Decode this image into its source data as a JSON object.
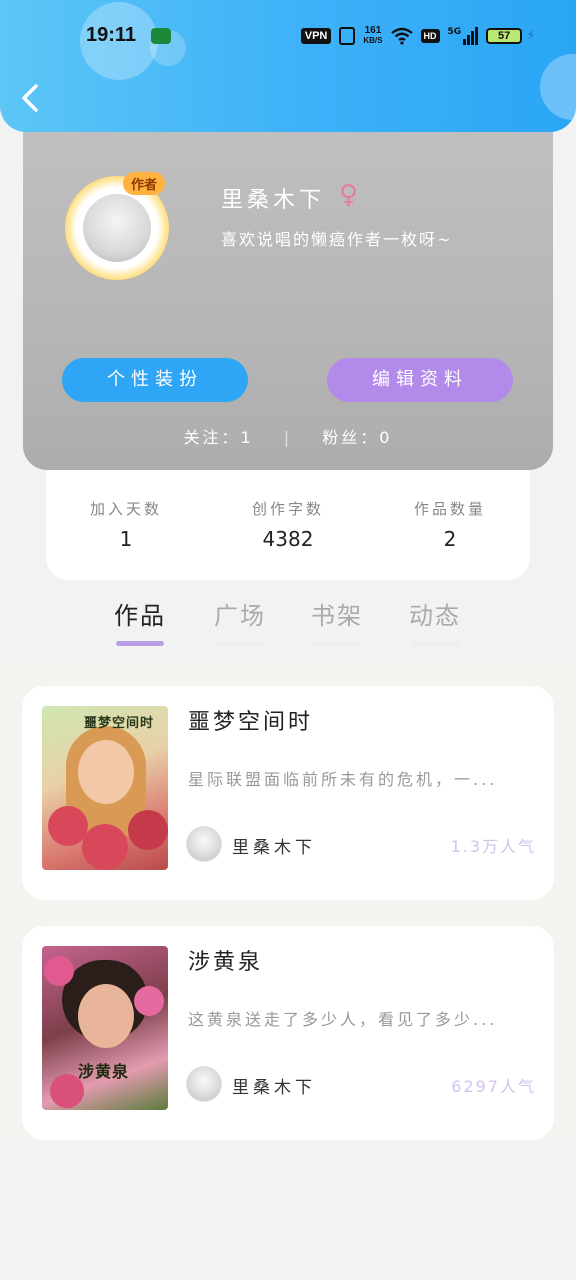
{
  "status_bar": {
    "time": "19:11",
    "vpn": "VPN",
    "net_speed_value": "161",
    "net_speed_unit": "KB/S",
    "hd": "HD",
    "signal": "5G",
    "battery": "57"
  },
  "header": {
    "back_icon": "chevron-left-icon",
    "gradient_start": "#5cc6f6",
    "gradient_end": "#2aa6f5"
  },
  "profile": {
    "author_tag": "作者",
    "username": "里桑木下",
    "gender_symbol": "♀",
    "bio": "喜欢说唱的懒癌作者一枚呀~",
    "style_button": "个性装扮",
    "edit_button": "编辑资料",
    "following_label": "关注：",
    "following_count": "1",
    "fans_label": "粉丝：",
    "fans_count": "0"
  },
  "stats": {
    "days_label": "加入天数",
    "days_value": "1",
    "words_label": "创作字数",
    "words_value": "4382",
    "works_label": "作品数量",
    "works_value": "2"
  },
  "tabs": [
    {
      "label": "作品"
    },
    {
      "label": "广场"
    },
    {
      "label": "书架"
    },
    {
      "label": "动态"
    }
  ],
  "works": [
    {
      "cover_title": "噩梦空间时",
      "title": "噩梦空间时",
      "desc": "星际联盟面临前所未有的危机，一...",
      "author": "里桑木下",
      "popularity": "1.3万人气"
    },
    {
      "cover_title": "涉黄泉",
      "title": "涉黄泉",
      "desc": "这黄泉送走了多少人，看见了多少...",
      "author": "里桑木下",
      "popularity": "6297人气"
    }
  ],
  "colors": {
    "accent_blue": "#2ea5f5",
    "accent_purple": "#b28bea",
    "tab_underline_active": "#b79de6",
    "popularity": "#d3c3ef"
  }
}
